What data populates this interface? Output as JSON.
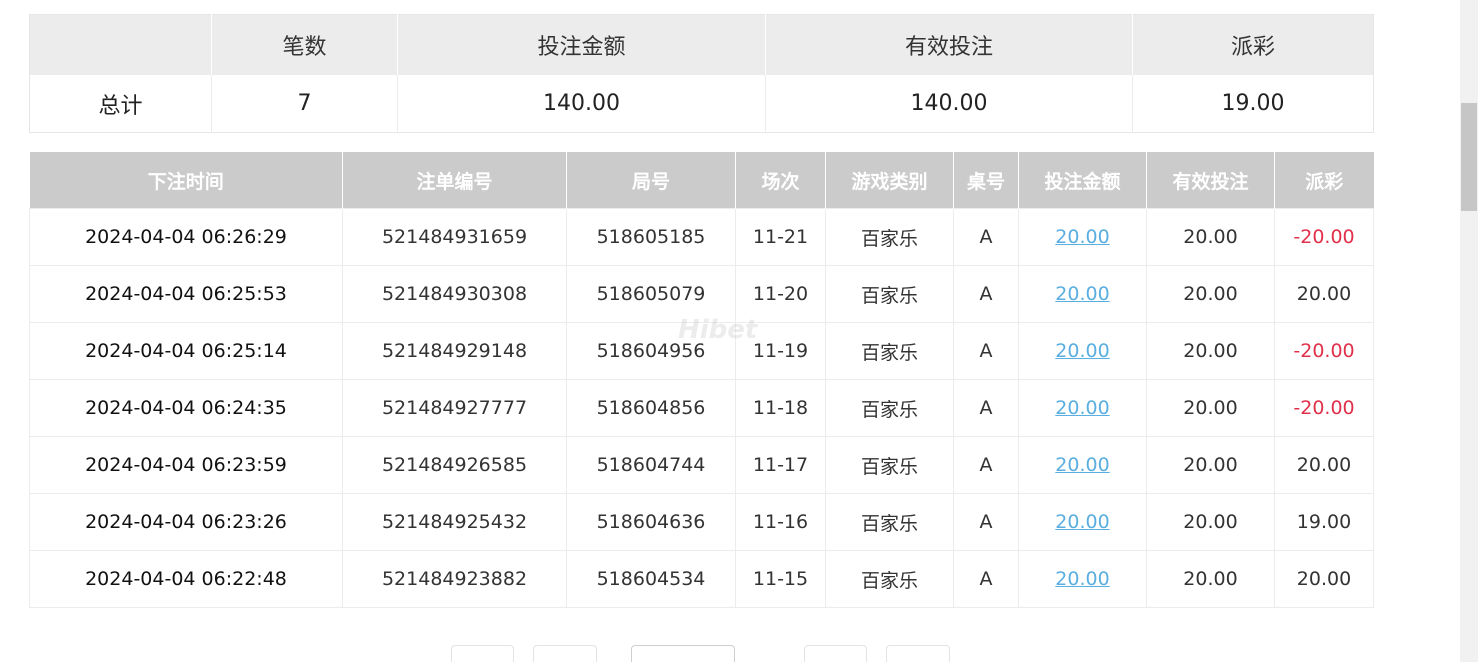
{
  "summary": {
    "headers": [
      "",
      "笔数",
      "投注金额",
      "有效投注",
      "派彩"
    ],
    "row": {
      "label": "总计",
      "count": "7",
      "bet": "140.00",
      "valid": "140.00",
      "payout": "19.00"
    }
  },
  "detail": {
    "headers": [
      "下注时间",
      "注单编号",
      "局号",
      "场次",
      "游戏类别",
      "桌号",
      "投注金额",
      "有效投注",
      "派彩"
    ],
    "rows": [
      {
        "time": "2024-04-04 06:26:29",
        "order": "521484931659",
        "round": "518605185",
        "session": "11-21",
        "game": "百家乐",
        "table": "A",
        "bet": "20.00",
        "valid": "20.00",
        "payout": "-20.00"
      },
      {
        "time": "2024-04-04 06:25:53",
        "order": "521484930308",
        "round": "518605079",
        "session": "11-20",
        "game": "百家乐",
        "table": "A",
        "bet": "20.00",
        "valid": "20.00",
        "payout": "20.00"
      },
      {
        "time": "2024-04-04 06:25:14",
        "order": "521484929148",
        "round": "518604956",
        "session": "11-19",
        "game": "百家乐",
        "table": "A",
        "bet": "20.00",
        "valid": "20.00",
        "payout": "-20.00"
      },
      {
        "time": "2024-04-04 06:24:35",
        "order": "521484927777",
        "round": "518604856",
        "session": "11-18",
        "game": "百家乐",
        "table": "A",
        "bet": "20.00",
        "valid": "20.00",
        "payout": "-20.00"
      },
      {
        "time": "2024-04-04 06:23:59",
        "order": "521484926585",
        "round": "518604744",
        "session": "11-17",
        "game": "百家乐",
        "table": "A",
        "bet": "20.00",
        "valid": "20.00",
        "payout": "20.00"
      },
      {
        "time": "2024-04-04 06:23:26",
        "order": "521484925432",
        "round": "518604636",
        "session": "11-16",
        "game": "百家乐",
        "table": "A",
        "bet": "20.00",
        "valid": "20.00",
        "payout": "19.00"
      },
      {
        "time": "2024-04-04 06:22:48",
        "order": "521484923882",
        "round": "518604534",
        "session": "11-15",
        "game": "百家乐",
        "table": "A",
        "bet": "20.00",
        "valid": "20.00",
        "payout": "20.00"
      }
    ]
  },
  "watermark": "Hibet",
  "colors": {
    "link": "#5aaee0",
    "negative": "#e0304a",
    "header_bg": "#cbcbcb",
    "summary_header_bg": "#ececec"
  }
}
